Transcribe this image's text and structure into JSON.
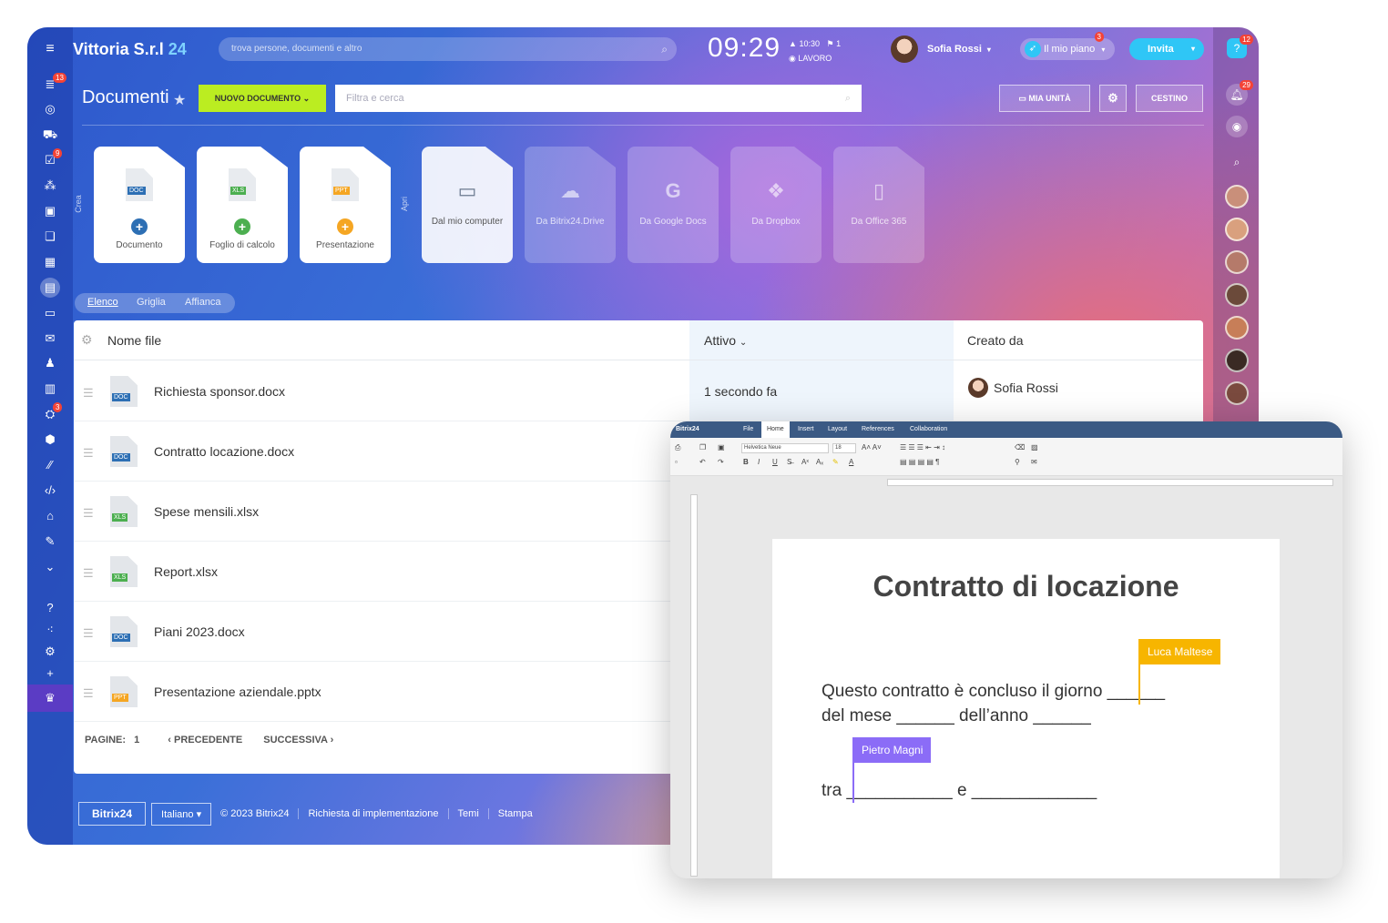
{
  "app": {
    "name": "Vittoria S.r.l",
    "number": "24"
  },
  "header": {
    "search_placeholder": "trova persone, documenti e altro",
    "clock": "09:29",
    "clock_alarm": "10:30",
    "clock_flag": "1",
    "status": "LAVORO",
    "user_name": "Sofia Rossi",
    "plan_label": "Il mio piano",
    "plan_badge": "3",
    "invite_label": "Invita"
  },
  "leftbar": {
    "badges": [
      "13",
      "9",
      "3"
    ]
  },
  "rightbar": {
    "help_badge": "12",
    "notif_badge": "29"
  },
  "page": {
    "title": "Documenti",
    "new_doc": "NUOVO DOCUMENTO",
    "filter_placeholder": "Filtra e cerca",
    "my_drive": "MIA UNITÀ",
    "trash": "CESTINO",
    "create_label": "Crea",
    "open_label": "Apri"
  },
  "create_tiles": [
    {
      "tag": "DOC",
      "label": "Documento"
    },
    {
      "tag": "XLS",
      "label": "Foglio di calcolo"
    },
    {
      "tag": "PPT",
      "label": "Presentazione"
    }
  ],
  "open_tiles": [
    "Dal mio computer",
    "Da Bitrix24.Drive",
    "Da Google Docs",
    "Da Dropbox",
    "Da Office 365"
  ],
  "views": [
    "Elenco",
    "Griglia",
    "Affianca"
  ],
  "table": {
    "headers": {
      "name": "Nome file",
      "active": "Attivo",
      "created_by": "Creato da"
    },
    "rows": [
      {
        "tag": "DOC",
        "name": "Richiesta sponsor.docx",
        "time": "1 secondo fa",
        "creator": "Sofia Rossi"
      },
      {
        "tag": "DOC",
        "name": "Contratto locazione.docx"
      },
      {
        "tag": "XLS",
        "name": "Spese mensili.xlsx"
      },
      {
        "tag": "XLS",
        "name": "Report.xlsx"
      },
      {
        "tag": "DOC",
        "name": "Piani 2023.docx"
      },
      {
        "tag": "PPT",
        "name": "Presentazione aziendale.pptx"
      }
    ],
    "pager": {
      "pages_label": "PAGINE:",
      "page": "1",
      "prev": "PRECEDENTE",
      "next": "SUCCESSIVA"
    }
  },
  "footer": {
    "brand": "Bitrix24",
    "language": "Italiano",
    "copyright": "© 2023 Bitrix24",
    "links": [
      "Richiesta di implementazione",
      "Temi",
      "Stampa"
    ]
  },
  "editor": {
    "brand": "Bitrix24",
    "menu": [
      "File",
      "Home",
      "Insert",
      "Layout",
      "References",
      "Collaboration"
    ],
    "font": "Helvetica Neue",
    "size": "18",
    "doc_title": "Contratto di locazione",
    "line1": "Questo contratto è concluso il giorno ______",
    "line2": "del mese ______ dell’anno ______",
    "line3": "tra ___________ e _____________",
    "collaborator1": "Luca Maltese",
    "collaborator2": "Pietro Magni"
  },
  "colors": {
    "accent": "#2fc6f6",
    "new_doc": "#bbed21",
    "doc": "#2d6fb4",
    "xls": "#4caf50",
    "ppt": "#f5a623",
    "collab1": "#f7b500",
    "collab2": "#8b6cf7"
  }
}
